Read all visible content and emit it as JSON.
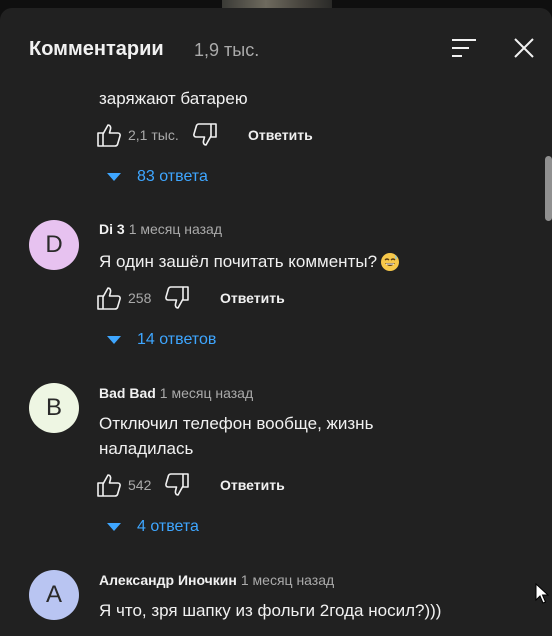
{
  "header": {
    "title": "Комментарии",
    "count": "1,9 тыс."
  },
  "icons": {
    "sort": "sort-icon",
    "close": "close-icon",
    "like": "thumb-up-icon",
    "dislike": "thumb-down-icon",
    "reply_caret": "caret-down-icon",
    "emoji": "grinning-sweat-emoji"
  },
  "colors": {
    "panel": "#212121",
    "link": "#3ea6ff",
    "text": "#f1f1f1",
    "muted": "#aaaaaa"
  },
  "comments": [
    {
      "text": "заряжают батарею",
      "likes": "2,1 тыс.",
      "reply_label": "Ответить",
      "replies_label": "83 ответа"
    },
    {
      "avatar": "D",
      "avatar_color": "#e7c2f0",
      "author": "Di 3",
      "time": "1 месяц назад",
      "text": "Я один зашёл почитать комменты?",
      "likes": "258",
      "reply_label": "Ответить",
      "replies_label": "14 ответов"
    },
    {
      "avatar": "B",
      "avatar_color": "#eef6e3",
      "author": "Bad Bad",
      "time": "1 месяц назад",
      "text_line1": "Отключил телефон вообще, жизнь",
      "text_line2": "наладилась",
      "likes": "542",
      "reply_label": "Ответить",
      "replies_label": "4 ответа"
    },
    {
      "avatar": "A",
      "avatar_color": "#b9c5f2",
      "author": "Александр Иночкин",
      "time": "1 месяц назад",
      "text": "Я что, зря шапку из фольги 2года носил?)))"
    }
  ]
}
